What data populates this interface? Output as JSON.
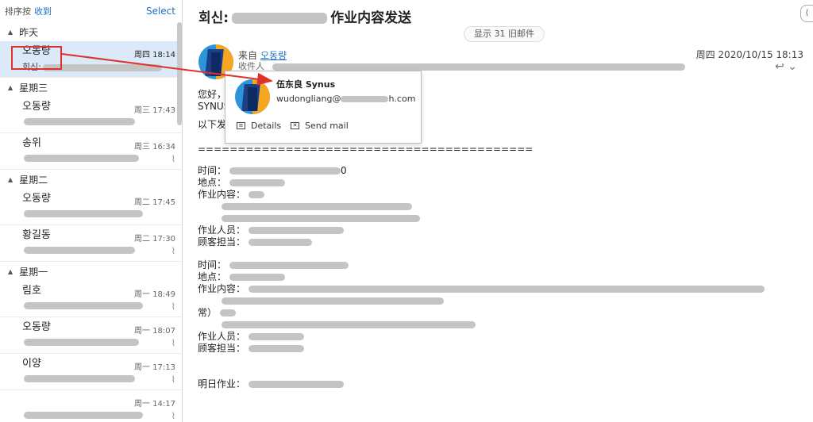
{
  "list_header": {
    "sort_label": "排序按",
    "sort_value": "收到",
    "select_label": "Select"
  },
  "groups": [
    {
      "label": "昨天",
      "messages": [
        {
          "sender": "오동량",
          "day": "周四 18:14",
          "subject_prefix": "회신:",
          "selected": true,
          "attachment": false
        }
      ]
    },
    {
      "label": "星期三",
      "messages": [
        {
          "sender": "오동량",
          "day": "周三 17:43",
          "subject_prefix": "",
          "selected": false,
          "attachment": false
        },
        {
          "sender": "송위",
          "day": "周三 16:34",
          "subject_prefix": "",
          "selected": false,
          "attachment": true
        }
      ]
    },
    {
      "label": "星期二",
      "messages": [
        {
          "sender": "오동량",
          "day": "周二 17:45",
          "subject_prefix": "",
          "selected": false,
          "attachment": false
        },
        {
          "sender": "황길동",
          "day": "周二 17:30",
          "subject_prefix": "",
          "selected": false,
          "attachment": true
        }
      ]
    },
    {
      "label": "星期一",
      "messages": [
        {
          "sender": "림호",
          "day": "周一 18:49",
          "subject_prefix": "",
          "selected": false,
          "attachment": true
        },
        {
          "sender": "오동량",
          "day": "周一 18:07",
          "subject_prefix": "",
          "selected": false,
          "attachment": true
        },
        {
          "sender": "이양",
          "day": "周一 17:13",
          "subject_prefix": "",
          "selected": false,
          "attachment": true
        },
        {
          "sender": "",
          "day": "周一 14:17",
          "subject_prefix": "",
          "selected": false,
          "attachment": true
        }
      ]
    }
  ],
  "reading": {
    "subject_prefix": "회신:",
    "subject_suffix": "作业内容发送",
    "show_older": "显示 31 旧邮件",
    "from_label": "来自",
    "from_name": "오동량",
    "to_label": "收件人",
    "date": "周四 2020/10/15 18:13",
    "body": {
      "greeting": "您好，",
      "company": "SYNUS",
      "intro": "以下发",
      "separator": "==========================================",
      "block1": [
        {
          "label": "时间：",
          "tail": "0"
        },
        {
          "label": "地点：",
          "tail": ""
        },
        {
          "label": "作业内容：",
          "tail": ""
        },
        {
          "label": "",
          "tail": ""
        },
        {
          "label": "",
          "tail": ""
        },
        {
          "label": "作业人员：",
          "tail": ""
        },
        {
          "label": "顾客担当：",
          "tail": ""
        }
      ],
      "block2": [
        {
          "label": "时间：",
          "tail": ""
        },
        {
          "label": "地点：",
          "tail": ""
        },
        {
          "label": "作业内容：",
          "tail": ""
        },
        {
          "label": "",
          "tail": ""
        },
        {
          "label": "常）",
          "tail": ""
        },
        {
          "label": "",
          "tail": ""
        },
        {
          "label": "作业人员：",
          "tail": ""
        },
        {
          "label": "顾客担当：",
          "tail": ""
        }
      ],
      "tomorrow": "明日作业："
    }
  },
  "contact_card": {
    "name": "伍东良 Synus",
    "email_user": "wudongliang@",
    "email_domain_tail": "h.com",
    "details_label": "Details",
    "send_mail_label": "Send mail"
  },
  "colors": {
    "accent": "#1a6fc7",
    "selected_row": "#dce9f8",
    "annotation": "#e0312b"
  }
}
